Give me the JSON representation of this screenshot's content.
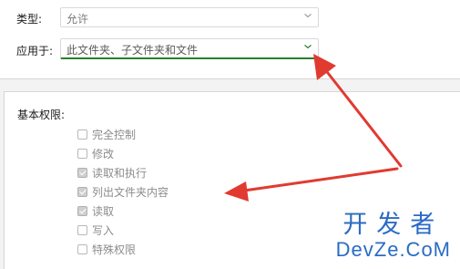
{
  "top": {
    "type_label": "类型:",
    "type_value": "允许",
    "applies_label": "应用于:",
    "applies_value": "此文件夹、子文件夹和文件"
  },
  "permissions": {
    "title": "基本权限:",
    "items": [
      {
        "label": "完全控制",
        "checked": false
      },
      {
        "label": "修改",
        "checked": false
      },
      {
        "label": "读取和执行",
        "checked": true
      },
      {
        "label": "列出文件夹内容",
        "checked": true
      },
      {
        "label": "读取",
        "checked": true
      },
      {
        "label": "写入",
        "checked": false
      },
      {
        "label": "特殊权限",
        "checked": false
      }
    ]
  },
  "watermark": {
    "line1": "开发者",
    "line2": "DevZe.CoM"
  },
  "colors": {
    "arrow": "#e03a31",
    "accent_green": "#2a7f2a",
    "watermark_blue": "#2a6bc4"
  },
  "icons": {
    "dropdown": "chevron-down-icon"
  }
}
